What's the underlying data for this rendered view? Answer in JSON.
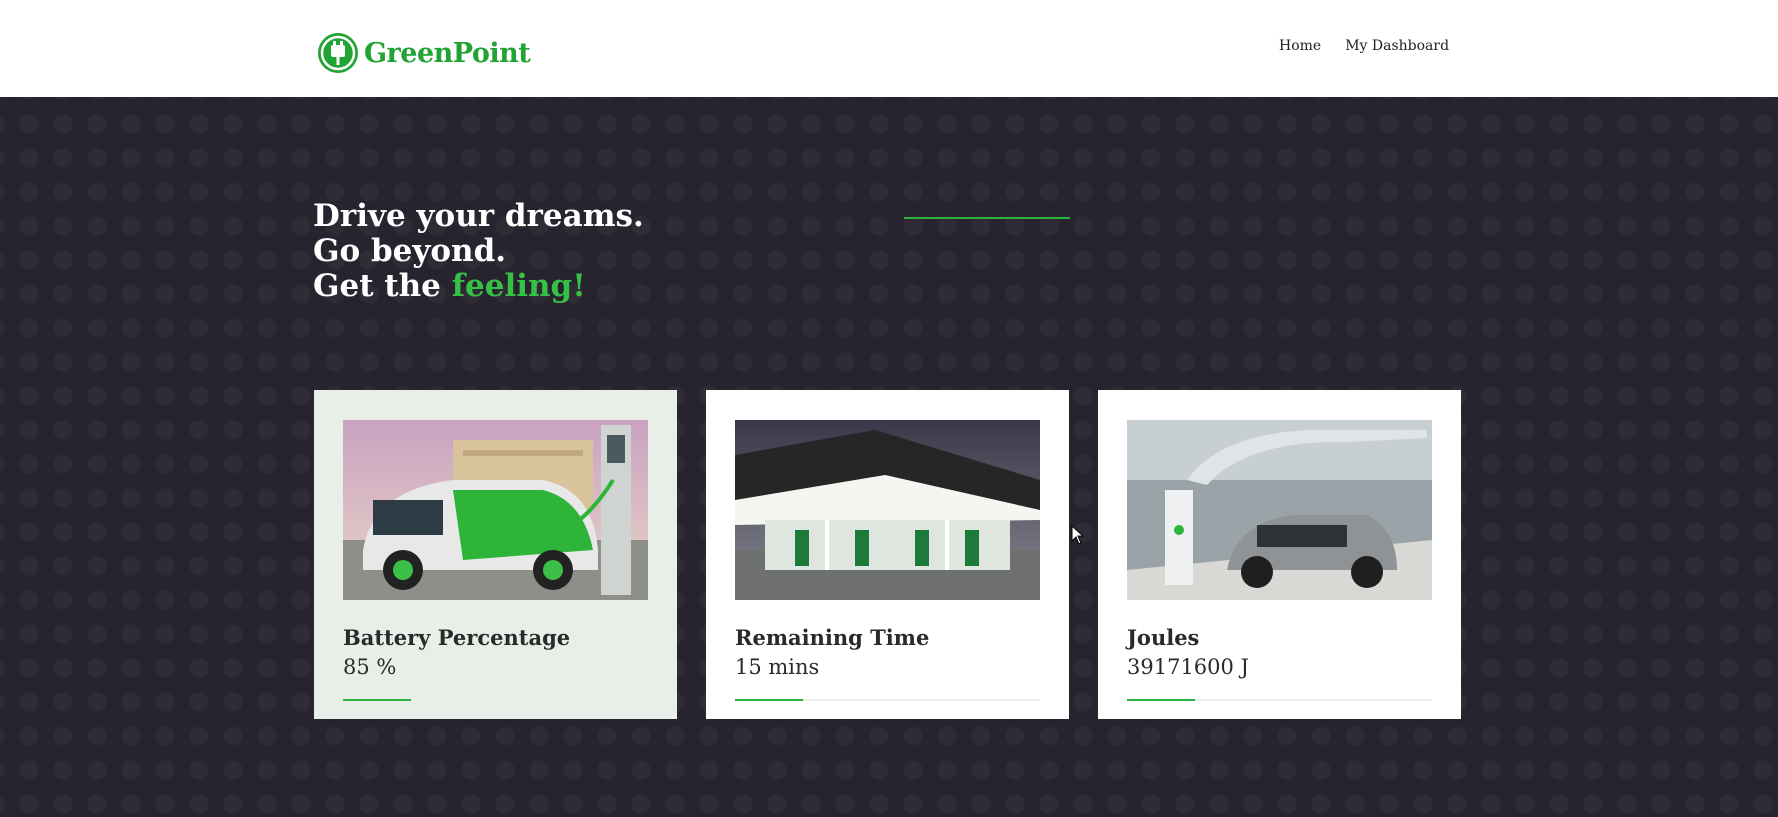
{
  "brand": {
    "name": "GreenPoint",
    "color": "#22a335"
  },
  "nav": {
    "items": [
      "Home",
      "My Dashboard"
    ]
  },
  "hero": {
    "line1": "Drive your dreams.",
    "line2": "Go beyond.",
    "line3_prefix": "Get the ",
    "line3_accent": "feeling!",
    "accent_color": "#35c046"
  },
  "cards": [
    {
      "title": "Battery Percentage",
      "value": "85 %",
      "image": "electric-car-charging-photo",
      "active": true
    },
    {
      "title": "Remaining Time",
      "value": "15 mins",
      "image": "charging-station-photo",
      "active": false
    },
    {
      "title": "Joules",
      "value": "39171600 J",
      "image": "bmw-charging-photo",
      "active": false
    }
  ]
}
